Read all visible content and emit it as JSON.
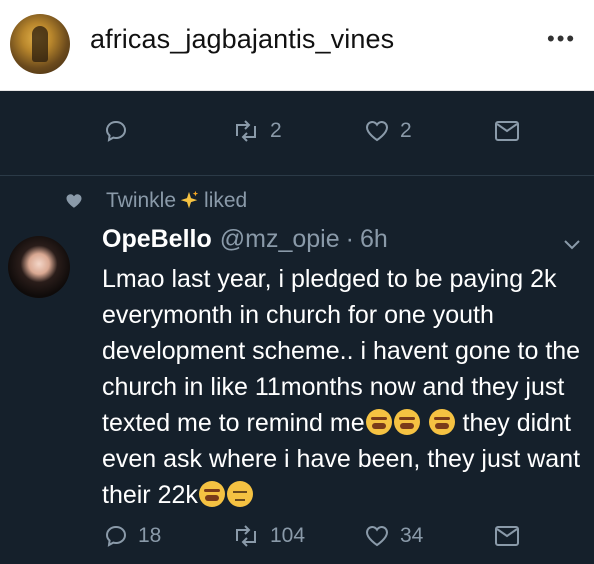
{
  "instagram": {
    "username": "africas_jagbajantis_vines",
    "more": "•••"
  },
  "top_actions": {
    "reply_count": "",
    "retweet_count": "2",
    "like_count": "2"
  },
  "liked_by": {
    "user": "Twinkle",
    "action": "liked"
  },
  "tweet": {
    "name": "OpeBello",
    "handle": "@mz_opie",
    "separator": "·",
    "time": "6h",
    "text_1": "Lmao last year, i pledged to be paying 2k everymonth in church for one youth development scheme.. i havent gone to the church in like 11months now and they just texted me to remind me",
    "text_2": " they didnt even ask where i have been, they just want their 22k",
    "emoji_names": [
      "sweat-smile-emoji",
      "sweat-smile-emoji",
      "sweat-smile-emoji",
      "sweat-smile-emoji",
      "expressionless-emoji"
    ]
  },
  "bottom_actions": {
    "reply_count": "18",
    "retweet_count": "104",
    "like_count": "34"
  },
  "colors": {
    "tweet_bg": "#15202b",
    "muted": "#8a9aa9",
    "text": "#ffffff"
  }
}
